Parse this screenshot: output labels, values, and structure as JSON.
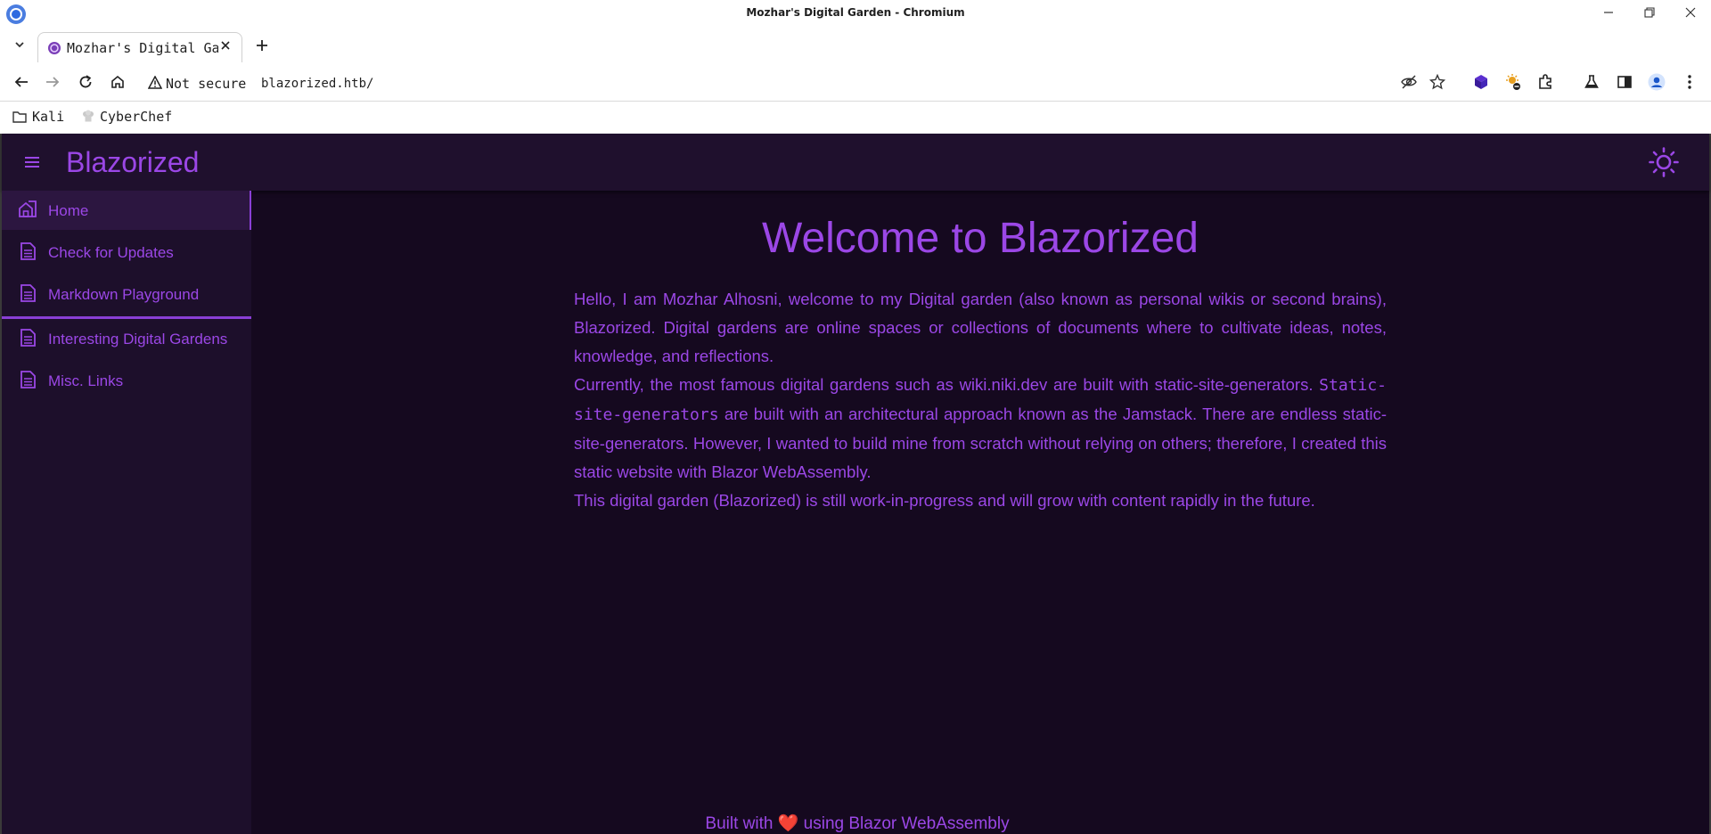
{
  "window": {
    "title": "Mozhar's Digital Garden - Chromium",
    "tab_title": "Mozhar's Digital Garden",
    "address_warning": "Not secure",
    "url": "blazorized.htb/"
  },
  "bookmarks": [
    {
      "label": "Kali",
      "icon": "folder-icon"
    },
    {
      "label": "CyberChef",
      "icon": "chef-hat-icon"
    }
  ],
  "app": {
    "brand": "Blazorized",
    "nav": [
      {
        "label": "Home",
        "icon": "home-icon",
        "active": true
      },
      {
        "label": "Check for Updates",
        "icon": "document-icon"
      },
      {
        "label": "Markdown Playground",
        "icon": "document-icon"
      },
      {
        "label": "Interesting Digital Gardens",
        "icon": "document-icon"
      },
      {
        "label": "Misc. Links",
        "icon": "document-icon"
      }
    ],
    "heading": "Welcome to Blazorized",
    "paragraph1": "Hello, I am Mozhar Alhosni, welcome to my Digital garden (also known as personal wikis or second brains), Blazorized. Digital gardens are online spaces or collections of documents where to cultivate ideas, notes, knowledge, and reflections.",
    "paragraph2_start": "Currently, the most famous digital gardens such as wiki.niki.dev are built with static-site-generators.",
    "paragraph2_code": "Static-site-generators",
    "paragraph2_end": " are built with an architectural approach known as the Jamstack. There are endless static-site-generators. However, I wanted to build mine from scratch without relying on others; therefore, I created this static website with Blazor WebAssembly.",
    "paragraph3": "This digital garden (Blazorized) is still work-in-progress and will grow with content rapidly in the future.",
    "footer_before": "Built with ",
    "footer_heart": "❤️",
    "footer_after": " using Blazor WebAssembly"
  },
  "colors": {
    "accent": "#9b47e6",
    "background": "#15091f",
    "drawer": "#1d0f2b",
    "appbar": "#1f102d"
  }
}
